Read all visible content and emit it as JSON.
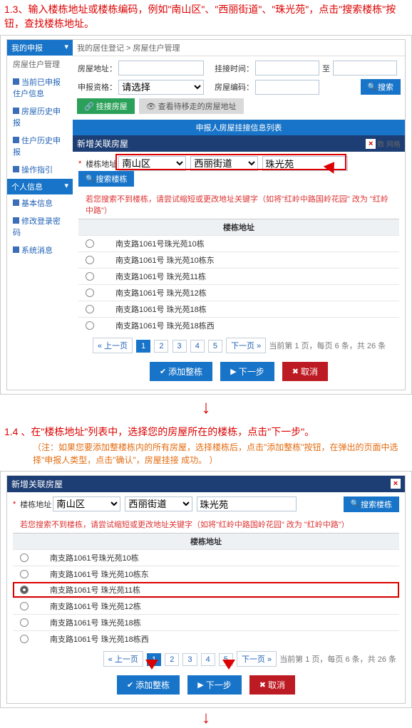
{
  "step13": {
    "head": "1.3、输入楼栋地址或楼栋编码，例如\"南山区\"、\"西丽街道\"、\"珠光苑\"，点击\"搜索楼栋\"按钮，查找楼栋地址。"
  },
  "breadcrumb": "我的居住登记 > 房屋住户管理",
  "form": {
    "addr_lab": "房屋地址：",
    "addr_val": "",
    "time_lab": "挂接时间：",
    "to": "至",
    "qual_lab": "申报资格：",
    "qual_val": "请选择",
    "code_lab": "房屋编码：",
    "search": "搜索"
  },
  "bar1": {
    "btn1": "挂接房屋",
    "btn2": "查看待移走的房屋地址",
    "title": "申报人房屋挂接信息列表"
  },
  "sb": {
    "head1": "我的申报",
    "g1": "房屋住户管理",
    "l1": "当前已申报住户信息",
    "l2": "房屋历史申报",
    "l3": "住户历史申报",
    "l4": "操作指引",
    "head2": "个人信息",
    "l5": "基本信息",
    "l6": "修改登录密码",
    "l7": "系统消息"
  },
  "tabtag": "数 网格",
  "modal": {
    "title": "新增关联房屋",
    "addr_lab": "楼栋地址",
    "district": "南山区",
    "street": "西丽街道",
    "block": "珠光苑",
    "search": "搜索楼栋",
    "note": "若您搜索不到楼栋，请尝试缩短或更改地址关键字（如将\"红岭中路国岭花园\" 改为 \"红岭中路\"）",
    "list_head": "楼栋地址",
    "rows": [
      "南支路1061号珠光苑10栋",
      "南支路1061号 珠光苑10栋东",
      "南支路1061号 珠光苑11栋",
      "南支路1061号 珠光苑12栋",
      "南支路1061号 珠光苑18栋",
      "南支路1061号 珠光苑18栋西"
    ],
    "pag": {
      "prev": "« 上一页",
      "p": [
        "1",
        "2",
        "3",
        "4",
        "5"
      ],
      "next": "下一页 »",
      "info": "当前第  1  页，每页  6  条，共 26 条"
    },
    "b_add": "添加整栋",
    "b_next": "下一步",
    "b_cancel": "取消"
  },
  "step14": {
    "head": "1.4 、在\"楼栋地址\"列表中，选择您的房屋所在的楼栋，点击\"下一步\"。",
    "note": "（注：如果您要添加整楼栋内的所有房屋，选择楼栋后，点击\"添加整栋\"按钮，在弹出的页面中选择\"申报人类型，点击\"确认\"，房屋挂接 成功。 ）"
  }
}
